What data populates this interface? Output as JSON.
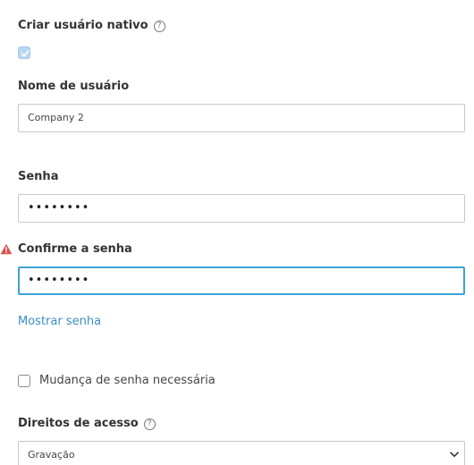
{
  "native_user": {
    "label": "Criar usuário nativo",
    "help_icon": "question-circle-icon",
    "checked": true
  },
  "username": {
    "label": "Nome de usuário",
    "value": "Company 2"
  },
  "password": {
    "label": "Senha",
    "value": "••••••••"
  },
  "confirm_password": {
    "label": "Confirme a senha",
    "value": "••••••••",
    "warning_icon": "warning-triangle-icon",
    "warning_color": "#d9534f"
  },
  "show_password_link": "Mostrar senha",
  "password_change_required": {
    "label": "Mudança de senha necessária",
    "checked": false
  },
  "access_rights": {
    "label": "Direitos de acesso",
    "help_icon": "question-circle-icon",
    "selected": "Gravação"
  },
  "colors": {
    "focus_border": "#3aa3d6",
    "link": "#3a8fc4",
    "checkbox_checked_bg": "#b8d7ef"
  }
}
